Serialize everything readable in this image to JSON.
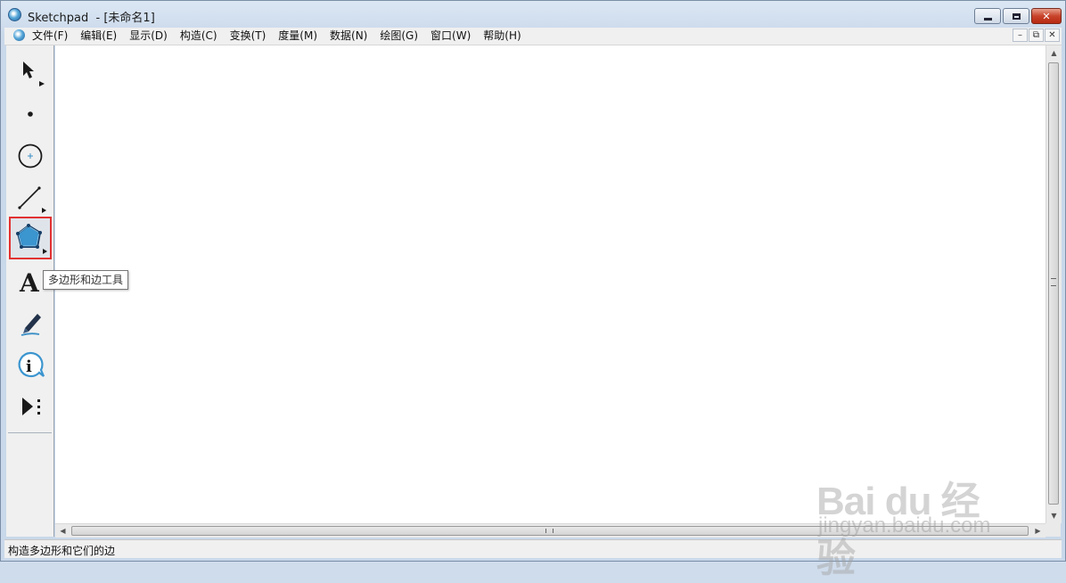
{
  "window": {
    "title": "Sketchpad  - [未命名1]"
  },
  "menu": {
    "items": [
      "文件(F)",
      "编辑(E)",
      "显示(D)",
      "构造(C)",
      "变换(T)",
      "度量(M)",
      "数据(N)",
      "绘图(G)",
      "窗口(W)",
      "帮助(H)"
    ]
  },
  "toolbox": {
    "tools": [
      {
        "name": "selection-arrow-tool",
        "icon": "arrow-icon"
      },
      {
        "name": "point-tool",
        "icon": "point-icon"
      },
      {
        "name": "compass-tool",
        "icon": "circle-icon"
      },
      {
        "name": "straightedge-tool",
        "icon": "segment-icon"
      },
      {
        "name": "polygon-tool",
        "icon": "pentagon-icon",
        "selected": true
      },
      {
        "name": "text-tool",
        "icon": "text-A-icon"
      },
      {
        "name": "marker-tool",
        "icon": "marker-icon"
      },
      {
        "name": "information-tool",
        "icon": "info-icon"
      },
      {
        "name": "custom-tool",
        "icon": "play-dots-icon"
      }
    ],
    "tooltip": "多边形和边工具",
    "selected_border_color": "#e23131"
  },
  "status": {
    "text": "构造多边形和它们的边"
  },
  "watermark": {
    "logo": "Bai du 经验",
    "url": "jingyan.baidu.com"
  }
}
